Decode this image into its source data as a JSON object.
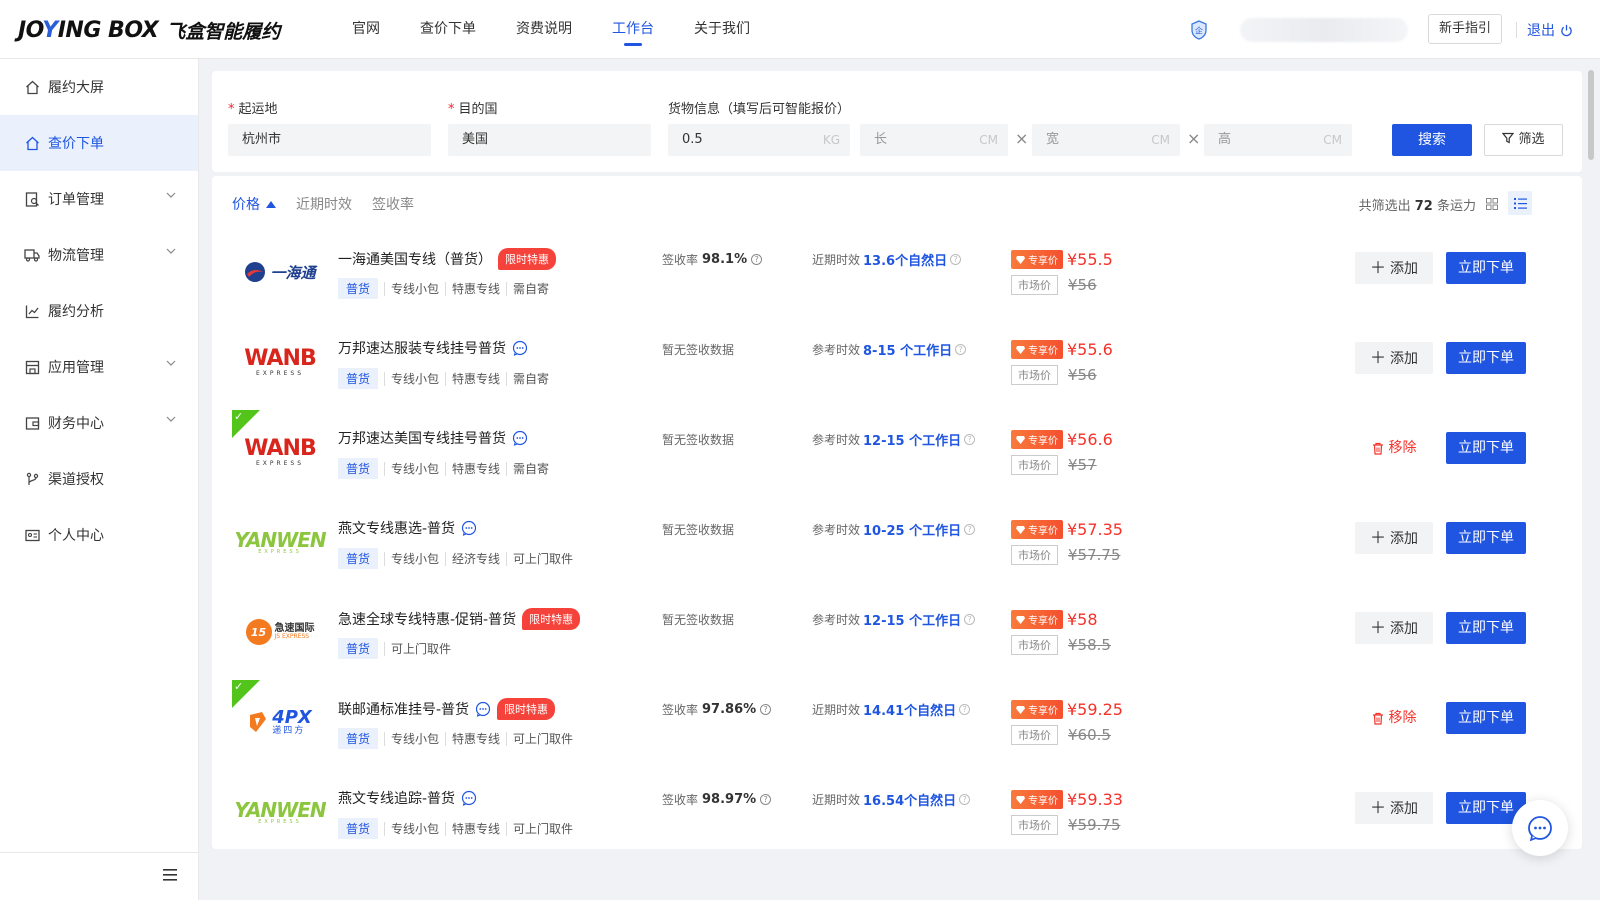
{
  "header": {
    "logo_en_a": "JO",
    "logo_en_x": "Y",
    "logo_en_b": "ING BOX",
    "logo_cn": "飞盒智能履约",
    "nav": [
      {
        "label": "官网",
        "active": false
      },
      {
        "label": "查价下单",
        "active": false
      },
      {
        "label": "资费说明",
        "active": false
      },
      {
        "label": "工作台",
        "active": true
      },
      {
        "label": "关于我们",
        "active": false
      }
    ],
    "guide_label": "新手指引",
    "logout_label": "退出"
  },
  "sidebar": {
    "items": [
      {
        "label": "履约大屏",
        "icon": "home-icon",
        "active": false,
        "expandable": false
      },
      {
        "label": "查价下单",
        "icon": "home-icon",
        "active": true,
        "expandable": false
      },
      {
        "label": "订单管理",
        "icon": "order-search-icon",
        "active": false,
        "expandable": true
      },
      {
        "label": "物流管理",
        "icon": "truck-icon",
        "active": false,
        "expandable": true
      },
      {
        "label": "履约分析",
        "icon": "line-chart-icon",
        "active": false,
        "expandable": false
      },
      {
        "label": "应用管理",
        "icon": "store-icon",
        "active": false,
        "expandable": true
      },
      {
        "label": "财务中心",
        "icon": "wallet-icon",
        "active": false,
        "expandable": true
      },
      {
        "label": "渠道授权",
        "icon": "branch-icon",
        "active": false,
        "expandable": false
      },
      {
        "label": "个人中心",
        "icon": "id-card-icon",
        "active": false,
        "expandable": false
      }
    ]
  },
  "search": {
    "origin_label": "起运地",
    "origin_value": "杭州市",
    "dest_label": "目的国",
    "dest_value": "美国",
    "cargo_label": "货物信息（填写后可智能报价）",
    "weight_value": "0.5",
    "weight_unit": "KG",
    "length_ph": "长",
    "width_ph": "宽",
    "height_ph": "高",
    "dim_unit": "CM",
    "times": "×",
    "search_btn": "搜索",
    "filter_btn": "筛选"
  },
  "results": {
    "sort": {
      "price": "价格",
      "recent": "近期时效",
      "sign": "签收率"
    },
    "count_prefix": "共筛选出",
    "count": "72",
    "count_suffix": "条运力",
    "vip_label": "专享价",
    "market_label": "市场价",
    "add_label": "添加",
    "remove_label": "移除",
    "order_label": "立即下单",
    "rows": [
      {
        "logo": "一海通",
        "title": "一海通美国专线（普货）",
        "promo": "限时特惠",
        "chat": false,
        "tags": [
          "普货",
          "专线小包",
          "特惠专线",
          "需自寄"
        ],
        "sign_label": "签收率",
        "sign_value": "98.1%",
        "eta_label": "近期时效",
        "eta_value": "13.6个自然日",
        "price": "¥55.5",
        "market_price": "¥56",
        "selected": false
      },
      {
        "logo": "WANB",
        "title": "万邦速达服装专线挂号普货",
        "promo": "",
        "chat": true,
        "tags": [
          "普货",
          "专线小包",
          "特惠专线",
          "需自寄"
        ],
        "sign_label": "暂无签收数据",
        "sign_value": "",
        "eta_label": "参考时效",
        "eta_value": "8-15 个工作日",
        "price": "¥55.6",
        "market_price": "¥56",
        "selected": false
      },
      {
        "logo": "WANB",
        "title": "万邦速达美国专线挂号普货",
        "promo": "",
        "chat": true,
        "tags": [
          "普货",
          "专线小包",
          "特惠专线",
          "需自寄"
        ],
        "sign_label": "暂无签收数据",
        "sign_value": "",
        "eta_label": "参考时效",
        "eta_value": "12-15 个工作日",
        "price": "¥56.6",
        "market_price": "¥57",
        "selected": true
      },
      {
        "logo": "YANWEN",
        "title": "燕文专线惠选-普货",
        "promo": "",
        "chat": true,
        "tags": [
          "普货",
          "专线小包",
          "经济专线",
          "可上门取件"
        ],
        "sign_label": "暂无签收数据",
        "sign_value": "",
        "eta_label": "参考时效",
        "eta_value": "10-25 个工作日",
        "price": "¥57.35",
        "market_price": "¥57.75",
        "selected": false
      },
      {
        "logo": "急速国际",
        "title": "急速全球专线特惠-促销-普货",
        "promo": "限时特惠",
        "chat": false,
        "tags": [
          "普货",
          "可上门取件"
        ],
        "sign_label": "暂无签收数据",
        "sign_value": "",
        "eta_label": "参考时效",
        "eta_value": "12-15 个工作日",
        "price": "¥58",
        "market_price": "¥58.5",
        "selected": false
      },
      {
        "logo": "4PX",
        "title": "联邮通标准挂号-普货",
        "promo": "限时特惠",
        "chat": true,
        "tags": [
          "普货",
          "专线小包",
          "特惠专线",
          "可上门取件"
        ],
        "sign_label": "签收率",
        "sign_value": "97.86%",
        "eta_label": "近期时效",
        "eta_value": "14.41个自然日",
        "price": "¥59.25",
        "market_price": "¥60.5",
        "selected": true
      },
      {
        "logo": "YANWEN",
        "title": "燕文专线追踪-普货",
        "promo": "",
        "chat": true,
        "tags": [
          "普货",
          "专线小包",
          "特惠专线",
          "可上门取件"
        ],
        "sign_label": "签收率",
        "sign_value": "98.97%",
        "eta_label": "近期时效",
        "eta_value": "16.54个自然日",
        "price": "¥59.33",
        "market_price": "¥59.75",
        "selected": false
      }
    ]
  },
  "logo_text": {
    "yihaitong": "一海通",
    "wanb": "WANB",
    "wanb_sub": "EXPRESS",
    "yanwen": "YANWEN",
    "yanwen_sub": "EXPRESS",
    "js_num": "15",
    "js_cn": "急速国际",
    "js_en": "JS EXPRESS",
    "fpx": "4PX",
    "fpx_cn": "递四方"
  },
  "colors": {
    "accent": "#1f55e0",
    "price": "#f5322a",
    "selected": "#52c41a"
  }
}
